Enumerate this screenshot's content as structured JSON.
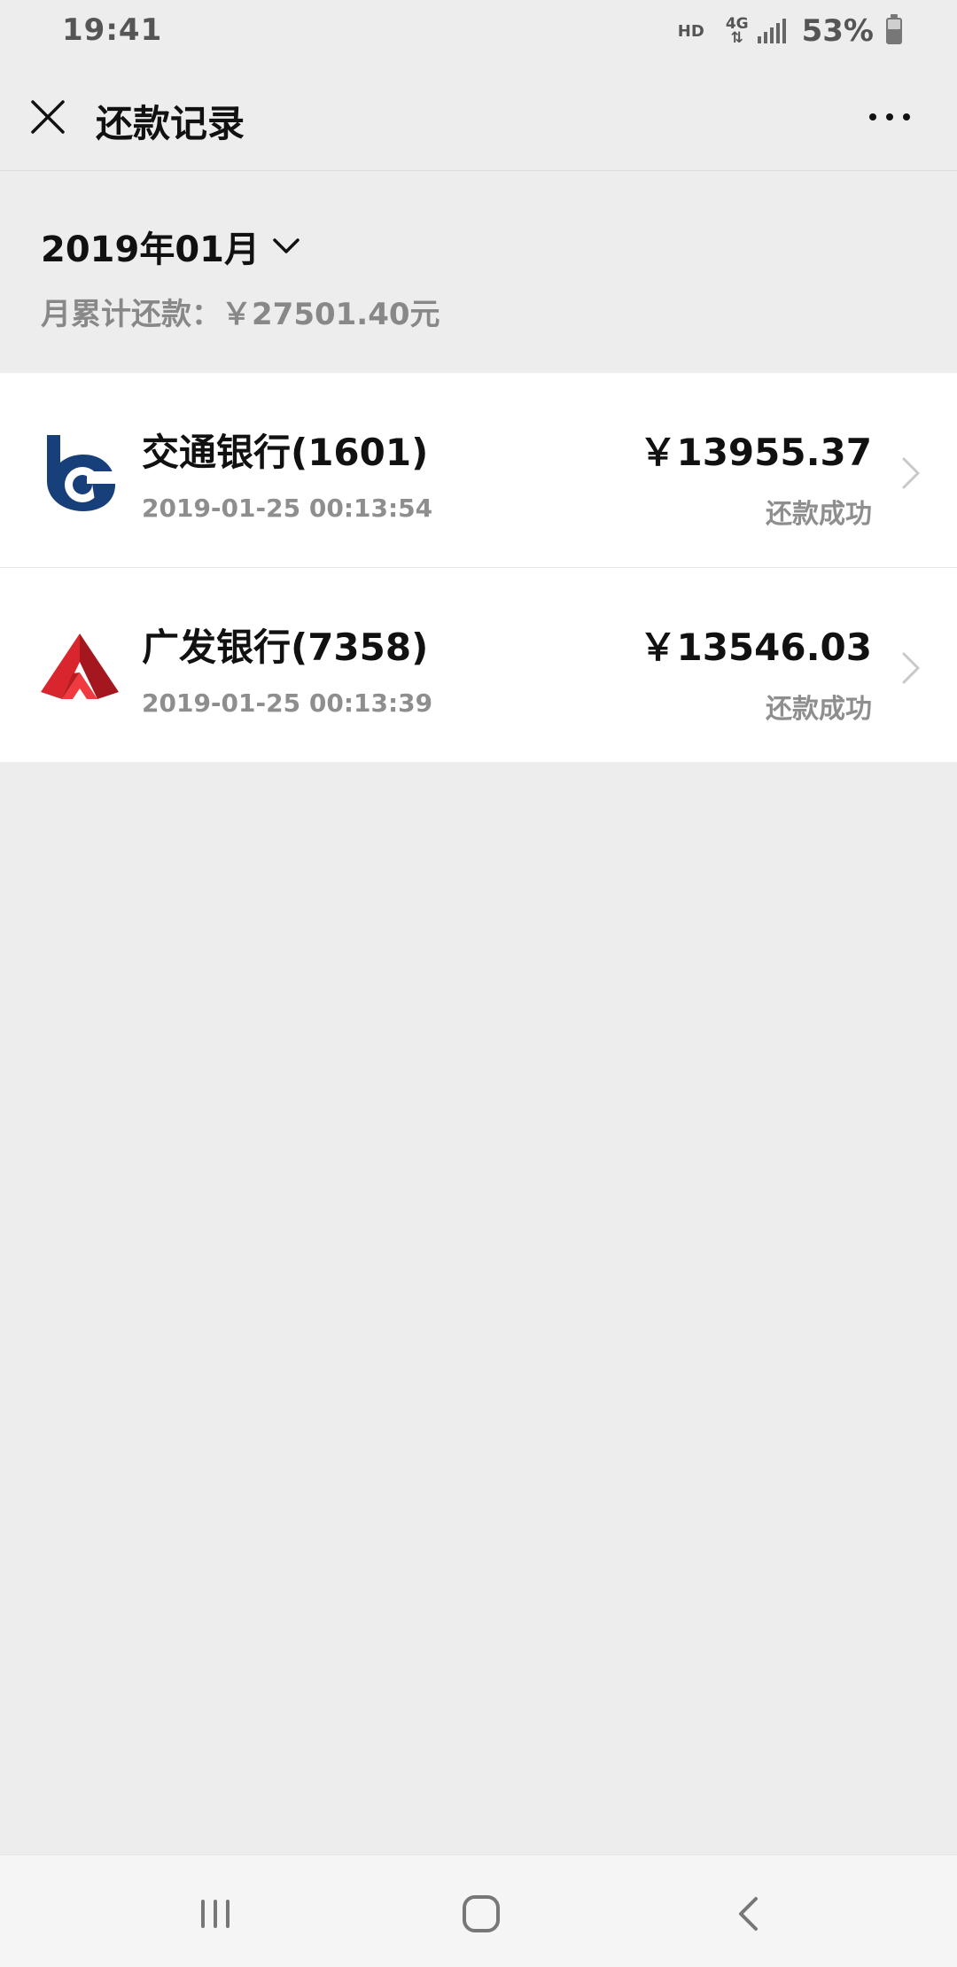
{
  "status_bar": {
    "time": "19:41",
    "hd": "HD",
    "network": "4G",
    "battery": "53%"
  },
  "header": {
    "title": "还款记录",
    "close_icon": "close-icon",
    "more_icon": "more-icon"
  },
  "summary": {
    "month": "2019年01月",
    "label": "月累计还款：",
    "total": "￥27501.40元"
  },
  "records": [
    {
      "bank": "交通银行(1601)",
      "time": "2019-01-25 00:13:54",
      "amount": "￥13955.37",
      "status": "还款成功",
      "logo_icon": "bank-of-communications-logo",
      "logo_color": "#173f7a"
    },
    {
      "bank": "广发银行(7358)",
      "time": "2019-01-25 00:13:39",
      "amount": "￥13546.03",
      "status": "还款成功",
      "logo_icon": "cgb-bank-logo",
      "logo_color": "#b81d24"
    }
  ],
  "colors": {
    "background": "#ededed",
    "card": "#ffffff",
    "primary_text": "#111111",
    "secondary_text": "#8e8e8e"
  }
}
